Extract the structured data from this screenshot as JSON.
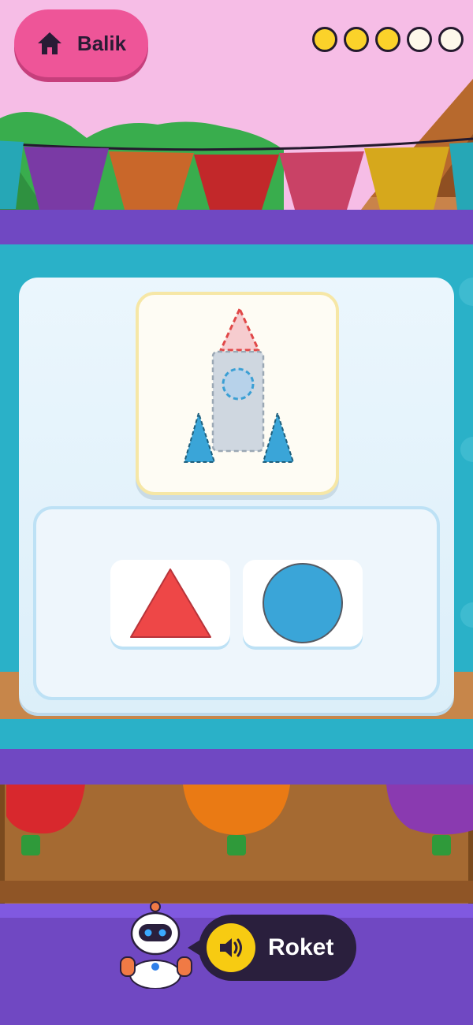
{
  "header": {
    "home_label": "Balik"
  },
  "progress": {
    "total": 5,
    "completed": 3,
    "filled_color": "#fbd22a",
    "empty_color": "#fdf8ea"
  },
  "puzzle": {
    "target_figure": "rocket",
    "target_parts": [
      "triangle-red-nose",
      "rectangle-grey-body",
      "circle-blue-window",
      "triangle-blue-fin-left",
      "triangle-blue-fin-right"
    ],
    "choices": [
      {
        "shape": "triangle",
        "color": "#ee4747"
      },
      {
        "shape": "circle",
        "color": "#3aa5d8"
      }
    ]
  },
  "prompt": {
    "word": "Roket",
    "speaker_icon": "speaker-icon"
  },
  "colors": {
    "home_button": "#ee5598",
    "purple_band": "#7048c2",
    "teal_background": "#2ab1c8"
  }
}
